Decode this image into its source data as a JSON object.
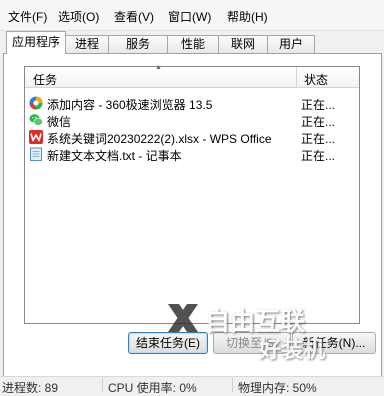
{
  "menu": {
    "file": "文件(F)",
    "options": "选项(O)",
    "view": "查看(V)",
    "window": "窗口(W)",
    "help": "帮助(H)"
  },
  "tabs": [
    "应用程序",
    "进程",
    "服务",
    "性能",
    "联网",
    "用户"
  ],
  "active_tab": "应用程序",
  "list": {
    "columns": {
      "task": "任务",
      "status": "状态"
    },
    "rows": [
      {
        "task": "添加内容 - 360极速浏览器 13.5",
        "status": "正在...",
        "icon": "browser-360-icon"
      },
      {
        "task": "微信",
        "status": "正在...",
        "icon": "wechat-icon"
      },
      {
        "task": "系统关键词20230222(2).xlsx - WPS Office",
        "status": "正在...",
        "icon": "wps-office-icon"
      },
      {
        "task": "新建文本文档.txt - 记事本",
        "status": "正在...",
        "icon": "notepad-icon"
      }
    ]
  },
  "buttons": {
    "end_task": "结束任务(E)",
    "switch_to": "切换至(S)",
    "new_task": "新任务(N)..."
  },
  "watermark": {
    "line1": "自由互联",
    "line2": "好装机"
  },
  "status_bar": {
    "processes": "进程数: 89",
    "cpu": "CPU 使用率: 0%",
    "memory": "物理内存: 50%"
  }
}
